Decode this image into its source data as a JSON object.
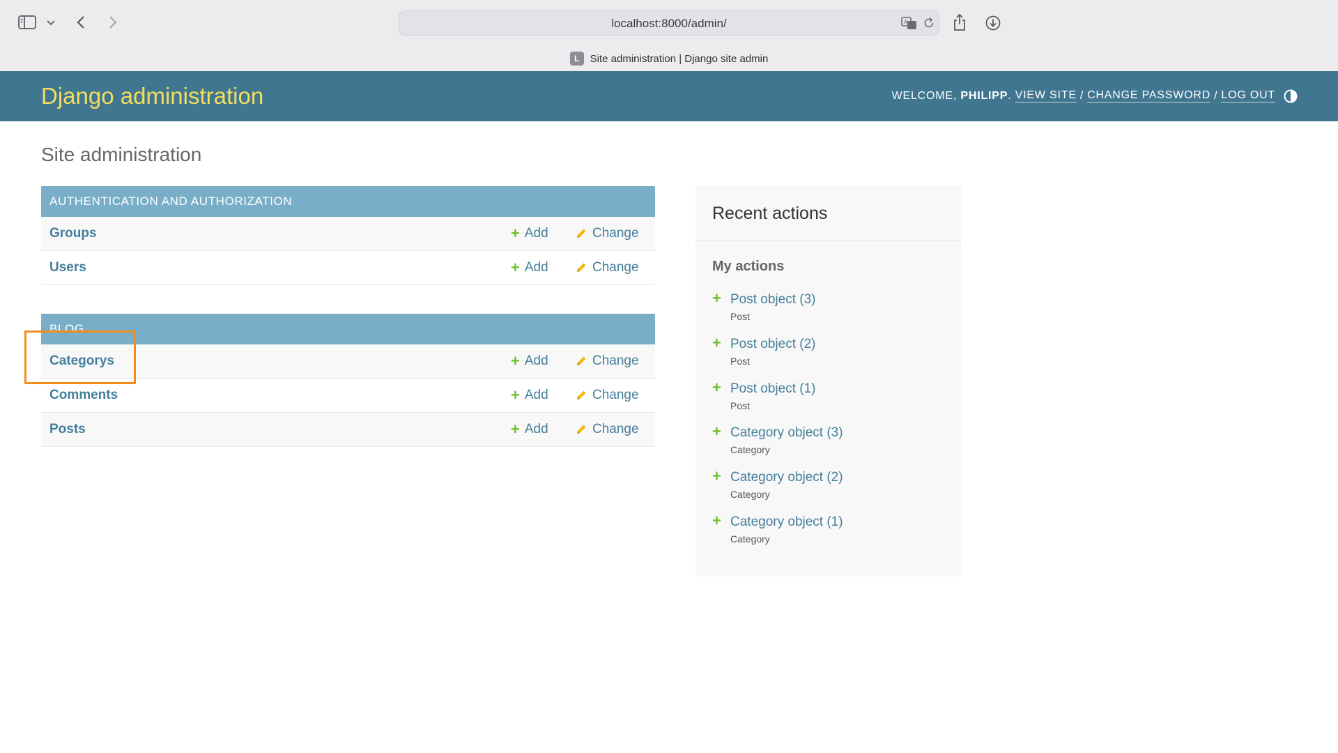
{
  "browser": {
    "url": "localhost:8000/admin/",
    "tab_title": "Site administration | Django site admin",
    "favicon_letter": "L",
    "icons": [
      "sidebar-icon",
      "chevron-down-icon",
      "back-icon",
      "forward-icon",
      "translate-icon",
      "reload-icon",
      "share-icon",
      "download-icon"
    ]
  },
  "header": {
    "brand": "Django administration",
    "welcome": "Welcome,",
    "user": "Philipp",
    "period": ".",
    "view_site": "View site",
    "change_password": "Change password",
    "log_out": "Log out",
    "slash": "/"
  },
  "page": {
    "title": "Site administration"
  },
  "modules": [
    {
      "caption": "Authentication and Authorization",
      "models": [
        {
          "name": "Groups",
          "add": "Add",
          "change": "Change"
        },
        {
          "name": "Users",
          "add": "Add",
          "change": "Change"
        }
      ]
    },
    {
      "caption": "Blog",
      "models": [
        {
          "name": "Categorys",
          "add": "Add",
          "change": "Change"
        },
        {
          "name": "Comments",
          "add": "Add",
          "change": "Change"
        },
        {
          "name": "Posts",
          "add": "Add",
          "change": "Change"
        }
      ]
    }
  ],
  "recent": {
    "title": "Recent actions",
    "subtitle": "My actions",
    "items": [
      {
        "label": "Post object (3)",
        "type": "Post"
      },
      {
        "label": "Post object (2)",
        "type": "Post"
      },
      {
        "label": "Post object (1)",
        "type": "Post"
      },
      {
        "label": "Category object (3)",
        "type": "Category"
      },
      {
        "label": "Category object (2)",
        "type": "Category"
      },
      {
        "label": "Category object (1)",
        "type": "Category"
      }
    ]
  },
  "colors": {
    "header_bg": "#417690",
    "brand": "#f5dd5d",
    "module_caption": "#79aec8",
    "link": "#447e9b",
    "add_icon": "#70bf2b",
    "change_icon": "#efb80b",
    "highlight": "#f28c1b"
  }
}
